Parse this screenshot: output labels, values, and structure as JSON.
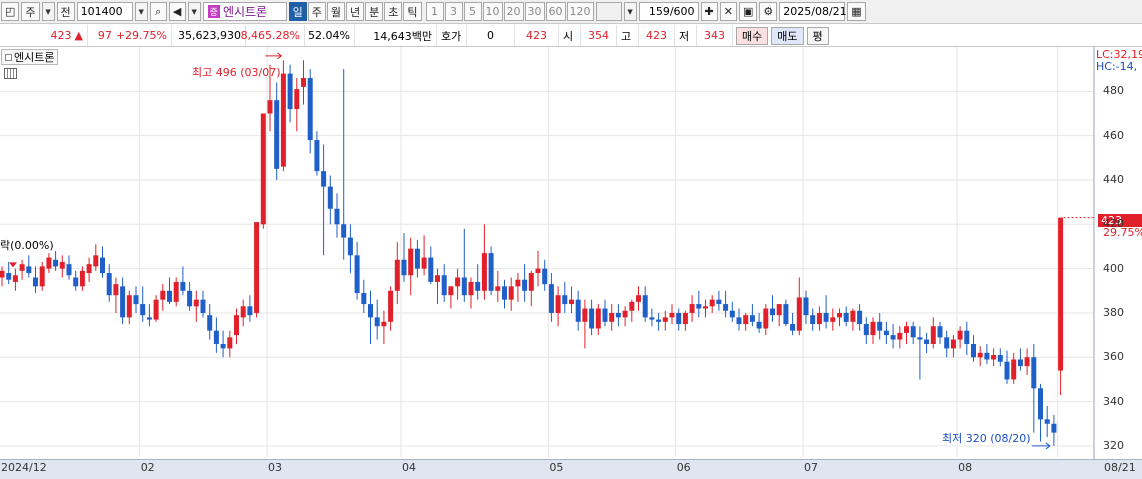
{
  "toolbar": {
    "mode_label": "주",
    "prev_label": "전",
    "code": "101400",
    "name_badge": "증",
    "name": "엔시트론",
    "periods": [
      {
        "label": "일",
        "selected": true
      },
      {
        "label": "주",
        "selected": false
      },
      {
        "label": "월",
        "selected": false
      },
      {
        "label": "년",
        "selected": false
      },
      {
        "label": "분",
        "selected": false
      },
      {
        "label": "초",
        "selected": false
      },
      {
        "label": "틱",
        "selected": false
      }
    ],
    "intervals": [
      "1",
      "3",
      "5",
      "10",
      "20",
      "30",
      "60",
      "120"
    ],
    "count": "159",
    "count_max": "/600",
    "date": "2025/08/21"
  },
  "quote": {
    "price": "423",
    "change": "97",
    "change_pct": "+29.75%",
    "volume": "35,623,930",
    "volume_ratio": "8,465.28%",
    "turnover": "52.04%",
    "amount": "14,643백만",
    "hoga_label": "호가",
    "hoga_value": "0",
    "bid_value": "423",
    "open_label": "시",
    "open_value": "354",
    "high_label": "고",
    "high_value": "423",
    "low_label": "저",
    "low_value": "343",
    "buy_label": "매수",
    "sell_label": "매도",
    "avg_label": "평"
  },
  "chart_labels": {
    "legend_name": "엔시트론",
    "lc": "LC:32,19",
    "hc": "HC:-14,",
    "last_price": "423",
    "last_pct": "29.75%",
    "ref": "락(0.00%)",
    "high_note": "최고 496 (03/07)",
    "low_note": "최저 320 (08/20)"
  },
  "colors": {
    "up": "#e0202a",
    "down": "#1f5fc8",
    "grid": "#e6e6e6",
    "axis_bar": "#dfe6f0"
  },
  "chart_data": {
    "type": "candlestick",
    "ylim": [
      315,
      500
    ],
    "yticks": [
      320,
      340,
      360,
      380,
      400,
      420,
      440,
      460,
      480
    ],
    "month_ticks": [
      {
        "label": "2024/12",
        "index": 0
      },
      {
        "label": "02",
        "index": 21
      },
      {
        "label": "03",
        "index": 40
      },
      {
        "label": "04",
        "index": 60
      },
      {
        "label": "05",
        "index": 82
      },
      {
        "label": "06",
        "index": 101
      },
      {
        "label": "07",
        "index": 120
      },
      {
        "label": "08",
        "index": 143
      },
      {
        "label": "08/21",
        "index": 158
      }
    ],
    "ohlc": [
      [
        396,
        401,
        392,
        399
      ],
      [
        398,
        403,
        393,
        395
      ],
      [
        394,
        400,
        390,
        397
      ],
      [
        399,
        404,
        395,
        402
      ],
      [
        401,
        406,
        396,
        398
      ],
      [
        396,
        401,
        389,
        392
      ],
      [
        392,
        403,
        390,
        401
      ],
      [
        400,
        407,
        398,
        405
      ],
      [
        404,
        408,
        399,
        401
      ],
      [
        400,
        406,
        396,
        403
      ],
      [
        402,
        406,
        395,
        397
      ],
      [
        396,
        399,
        390,
        392
      ],
      [
        392,
        401,
        390,
        399
      ],
      [
        398,
        405,
        394,
        402
      ],
      [
        401,
        411,
        399,
        406
      ],
      [
        405,
        410,
        396,
        398
      ],
      [
        398,
        402,
        385,
        388
      ],
      [
        388,
        396,
        380,
        393
      ],
      [
        392,
        396,
        375,
        378
      ],
      [
        378,
        390,
        375,
        388
      ],
      [
        388,
        392,
        380,
        384
      ],
      [
        384,
        392,
        376,
        379
      ],
      [
        378,
        384,
        374,
        377
      ],
      [
        377,
        388,
        376,
        386
      ],
      [
        386,
        393,
        381,
        390
      ],
      [
        390,
        396,
        384,
        385
      ],
      [
        385,
        396,
        383,
        394
      ],
      [
        394,
        401,
        388,
        390
      ],
      [
        390,
        394,
        381,
        383
      ],
      [
        383,
        390,
        376,
        386
      ],
      [
        386,
        390,
        378,
        380
      ],
      [
        379,
        384,
        368,
        372
      ],
      [
        372,
        378,
        362,
        366
      ],
      [
        366,
        372,
        360,
        364
      ],
      [
        364,
        372,
        360,
        369
      ],
      [
        370,
        382,
        366,
        379
      ],
      [
        378,
        386,
        374,
        383
      ],
      [
        383,
        388,
        376,
        379
      ],
      [
        380,
        420,
        378,
        421
      ],
      [
        420,
        442,
        418,
        470
      ],
      [
        470,
        492,
        462,
        476
      ],
      [
        476,
        484,
        440,
        445
      ],
      [
        446,
        494,
        444,
        488
      ],
      [
        488,
        492,
        466,
        472
      ],
      [
        472,
        486,
        462,
        481
      ],
      [
        482,
        494,
        474,
        486
      ],
      [
        486,
        490,
        452,
        458
      ],
      [
        458,
        462,
        442,
        444
      ],
      [
        444,
        456,
        406,
        437
      ],
      [
        437,
        442,
        420,
        427
      ],
      [
        427,
        434,
        414,
        420
      ],
      [
        420,
        490,
        404,
        414
      ],
      [
        414,
        420,
        398,
        406
      ],
      [
        406,
        412,
        386,
        389
      ],
      [
        389,
        395,
        380,
        384
      ],
      [
        384,
        390,
        366,
        378
      ],
      [
        378,
        386,
        368,
        374
      ],
      [
        374,
        381,
        366,
        376
      ],
      [
        376,
        392,
        372,
        390
      ],
      [
        390,
        412,
        384,
        404
      ],
      [
        404,
        416,
        394,
        397
      ],
      [
        397,
        414,
        388,
        409
      ],
      [
        409,
        413,
        396,
        400
      ],
      [
        400,
        415,
        397,
        405
      ],
      [
        405,
        410,
        393,
        394
      ],
      [
        394,
        400,
        384,
        397
      ],
      [
        397,
        402,
        385,
        388
      ],
      [
        388,
        392,
        382,
        392
      ],
      [
        392,
        400,
        386,
        396
      ],
      [
        396,
        418,
        385,
        388
      ],
      [
        388,
        396,
        382,
        394
      ],
      [
        394,
        402,
        386,
        390
      ],
      [
        390,
        420,
        386,
        407
      ],
      [
        407,
        410,
        388,
        390
      ],
      [
        390,
        399,
        385,
        392
      ],
      [
        392,
        395,
        382,
        386
      ],
      [
        386,
        396,
        381,
        392
      ],
      [
        392,
        398,
        385,
        395
      ],
      [
        395,
        402,
        385,
        390
      ],
      [
        390,
        399,
        383,
        398
      ],
      [
        398,
        408,
        392,
        400
      ],
      [
        400,
        404,
        390,
        393
      ],
      [
        393,
        398,
        376,
        380
      ],
      [
        380,
        392,
        374,
        388
      ],
      [
        388,
        394,
        380,
        384
      ],
      [
        384,
        392,
        380,
        386
      ],
      [
        386,
        390,
        372,
        376
      ],
      [
        376,
        386,
        364,
        382
      ],
      [
        382,
        386,
        370,
        373
      ],
      [
        373,
        384,
        370,
        382
      ],
      [
        382,
        386,
        374,
        376
      ],
      [
        376,
        384,
        372,
        380
      ],
      [
        380,
        384,
        374,
        378
      ],
      [
        378,
        383,
        374,
        381
      ],
      [
        381,
        386,
        376,
        385
      ],
      [
        385,
        392,
        381,
        388
      ],
      [
        388,
        392,
        376,
        378
      ],
      [
        378,
        382,
        374,
        377
      ],
      [
        377,
        380,
        372,
        376
      ],
      [
        376,
        381,
        372,
        378
      ],
      [
        378,
        384,
        375,
        380
      ],
      [
        380,
        382,
        372,
        375
      ],
      [
        375,
        381,
        372,
        380
      ],
      [
        380,
        388,
        376,
        384
      ],
      [
        384,
        390,
        378,
        382
      ],
      [
        382,
        386,
        378,
        383
      ],
      [
        383,
        388,
        380,
        386
      ],
      [
        386,
        390,
        381,
        384
      ],
      [
        384,
        390,
        378,
        381
      ],
      [
        381,
        385,
        376,
        378
      ],
      [
        378,
        382,
        372,
        375
      ],
      [
        375,
        380,
        372,
        379
      ],
      [
        379,
        384,
        374,
        376
      ],
      [
        376,
        380,
        371,
        373
      ],
      [
        373,
        384,
        370,
        382
      ],
      [
        382,
        388,
        376,
        379
      ],
      [
        379,
        384,
        374,
        384
      ],
      [
        384,
        386,
        374,
        375
      ],
      [
        375,
        380,
        370,
        372
      ],
      [
        372,
        396,
        370,
        387
      ],
      [
        387,
        390,
        375,
        379
      ],
      [
        379,
        382,
        372,
        375
      ],
      [
        375,
        383,
        372,
        380
      ],
      [
        380,
        388,
        373,
        376
      ],
      [
        376,
        382,
        372,
        378
      ],
      [
        378,
        382,
        374,
        380
      ],
      [
        380,
        383,
        374,
        376
      ],
      [
        376,
        382,
        372,
        381
      ],
      [
        381,
        384,
        372,
        375
      ],
      [
        375,
        378,
        366,
        370
      ],
      [
        370,
        378,
        366,
        376
      ],
      [
        376,
        380,
        368,
        372
      ],
      [
        372,
        376,
        366,
        370
      ],
      [
        370,
        375,
        364,
        368
      ],
      [
        368,
        374,
        364,
        371
      ],
      [
        371,
        376,
        366,
        374
      ],
      [
        374,
        376,
        366,
        369
      ],
      [
        369,
        374,
        350,
        368
      ],
      [
        368,
        371,
        362,
        366
      ],
      [
        366,
        378,
        364,
        374
      ],
      [
        374,
        376,
        366,
        369
      ],
      [
        369,
        372,
        360,
        364
      ],
      [
        364,
        370,
        360,
        368
      ],
      [
        368,
        374,
        364,
        372
      ],
      [
        372,
        376,
        361,
        366
      ],
      [
        366,
        370,
        358,
        360
      ],
      [
        360,
        365,
        356,
        362
      ],
      [
        362,
        366,
        357,
        359
      ],
      [
        359,
        364,
        356,
        361
      ],
      [
        361,
        364,
        356,
        358
      ],
      [
        358,
        363,
        348,
        350
      ],
      [
        350,
        362,
        348,
        359
      ],
      [
        359,
        364,
        354,
        356
      ],
      [
        356,
        364,
        352,
        360
      ],
      [
        360,
        366,
        326,
        346
      ],
      [
        346,
        348,
        322,
        332
      ],
      [
        332,
        338,
        324,
        330
      ],
      [
        330,
        334,
        320,
        326
      ],
      [
        354,
        423,
        343,
        423
      ]
    ]
  }
}
